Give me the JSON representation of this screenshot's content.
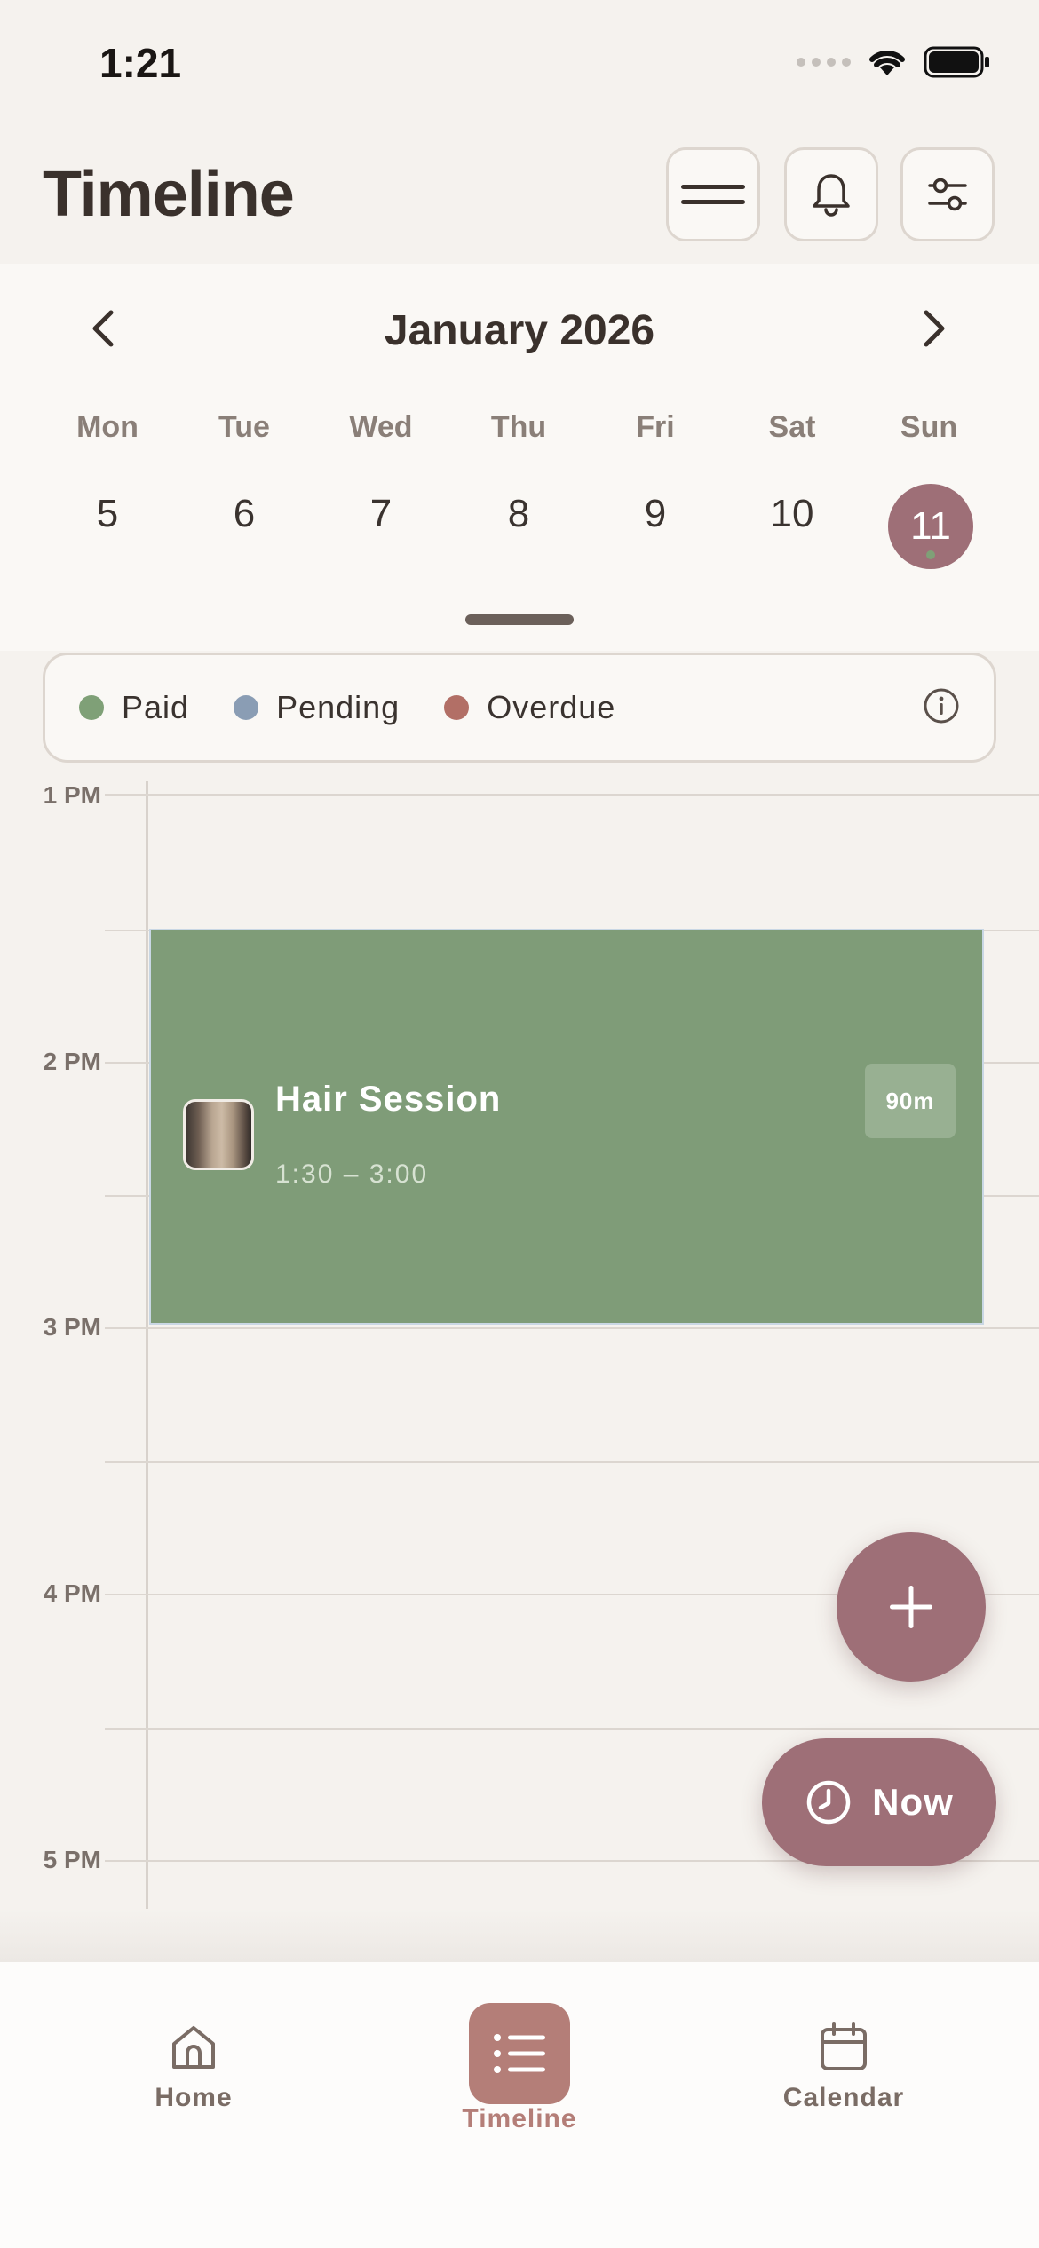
{
  "status_bar": {
    "time": "1:21"
  },
  "header": {
    "title": "Timeline"
  },
  "calendar": {
    "month": "January 2026",
    "weekdays": [
      "Mon",
      "Tue",
      "Wed",
      "Thu",
      "Fri",
      "Sat",
      "Sun"
    ],
    "days": [
      "5",
      "6",
      "7",
      "8",
      "9",
      "10",
      "11"
    ],
    "selected_day": "11"
  },
  "legend": {
    "items": [
      {
        "label": "Paid",
        "color": "#7fa077"
      },
      {
        "label": "Pending",
        "color": "#8a9db4"
      },
      {
        "label": "Overdue",
        "color": "#b26f66"
      }
    ]
  },
  "timeline": {
    "hours": [
      "1 PM",
      "2 PM",
      "3 PM",
      "4 PM",
      "5 PM"
    ]
  },
  "event": {
    "title": "Hair Session",
    "time": "1:30 – 3:00",
    "duration": "90m",
    "status_color": "#7f9c78"
  },
  "fab": {
    "now_label": "Now"
  },
  "tabbar": {
    "items": [
      {
        "label": "Home",
        "icon": "home-icon"
      },
      {
        "label": "Timeline",
        "icon": "list-icon"
      },
      {
        "label": "Calendar",
        "icon": "calendar-icon"
      }
    ],
    "active": "Timeline"
  },
  "colors": {
    "accent": "#9e6f77",
    "tab_active": "#b47e78",
    "background": "#f5f2ee"
  }
}
